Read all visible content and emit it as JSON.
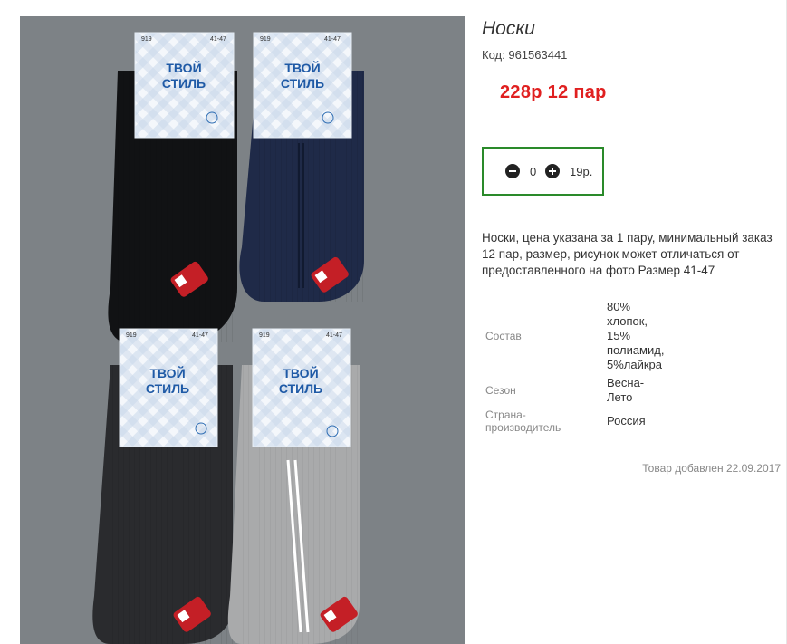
{
  "product": {
    "title": "Носки",
    "code_label": "Код:",
    "code_value": "961563441",
    "price_text": "228р 12 пар",
    "quantity": "0",
    "unit_price": "19р.",
    "description": "Носки, цена указана за 1 пару, минимальный заказ 12 пар, размер, рисунок может отличаться от предоставленного на фото Размер 41-47",
    "specs": [
      {
        "label": "Состав",
        "value": "80%\nхлопок,\n15%\nполиамид,\n5%лайкра"
      },
      {
        "label": "Сезон",
        "value": "Весна-\nЛето"
      },
      {
        "label": "Страна-\nпроизводитель",
        "value": "Россия"
      }
    ],
    "date_added": "Товар добавлен 22.09.2017"
  },
  "photo": {
    "background": "#7d8286",
    "packs": [
      {
        "brand": "ТВОЙ\nСТИЛЬ",
        "model": "919",
        "size": "41-47",
        "sock_color": "#111214"
      },
      {
        "brand": "ТВОЙ\nСТИЛЬ",
        "model": "919",
        "size": "41-47",
        "sock_color": "#1f2a48"
      },
      {
        "brand": "ТВОЙ\nСТИЛЬ",
        "model": "919",
        "size": "41-47",
        "sock_color": "#2a2b2e"
      },
      {
        "brand": "ТВОЙ\nСТИЛЬ",
        "model": "919",
        "size": "41-47",
        "sock_color": "#a9aaab"
      }
    ]
  },
  "colors": {
    "price": "#e02020",
    "qty_border": "#2a8a2a"
  }
}
